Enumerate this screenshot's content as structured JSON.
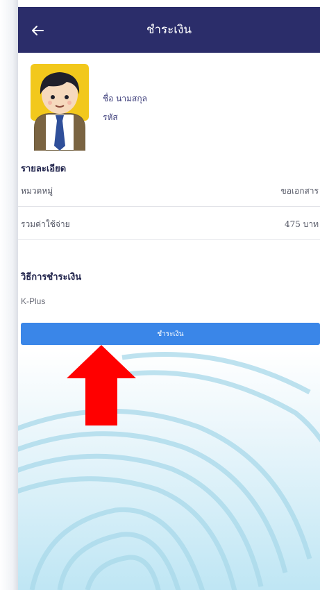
{
  "header": {
    "title": "ชำระเงิน"
  },
  "profile": {
    "name_label": "ชื่อ นามสกุล",
    "code_label": "รหัส"
  },
  "details": {
    "heading": "รายละเอียด",
    "rows": [
      {
        "key": "หมวดหมู่",
        "value": "ขอเอกสาร"
      },
      {
        "key": "รวมค่าใช้จ่าย",
        "value": "475 บาท"
      }
    ]
  },
  "payment": {
    "heading": "วิธีการชำระเงิน",
    "method": "K-Plus",
    "button_label": "ชำระเงิน"
  },
  "colors": {
    "appbar": "#2b2d6a",
    "button": "#3a86e8",
    "annotation_arrow": "#ff0000"
  },
  "icons": {
    "back": "arrow-left-icon"
  }
}
